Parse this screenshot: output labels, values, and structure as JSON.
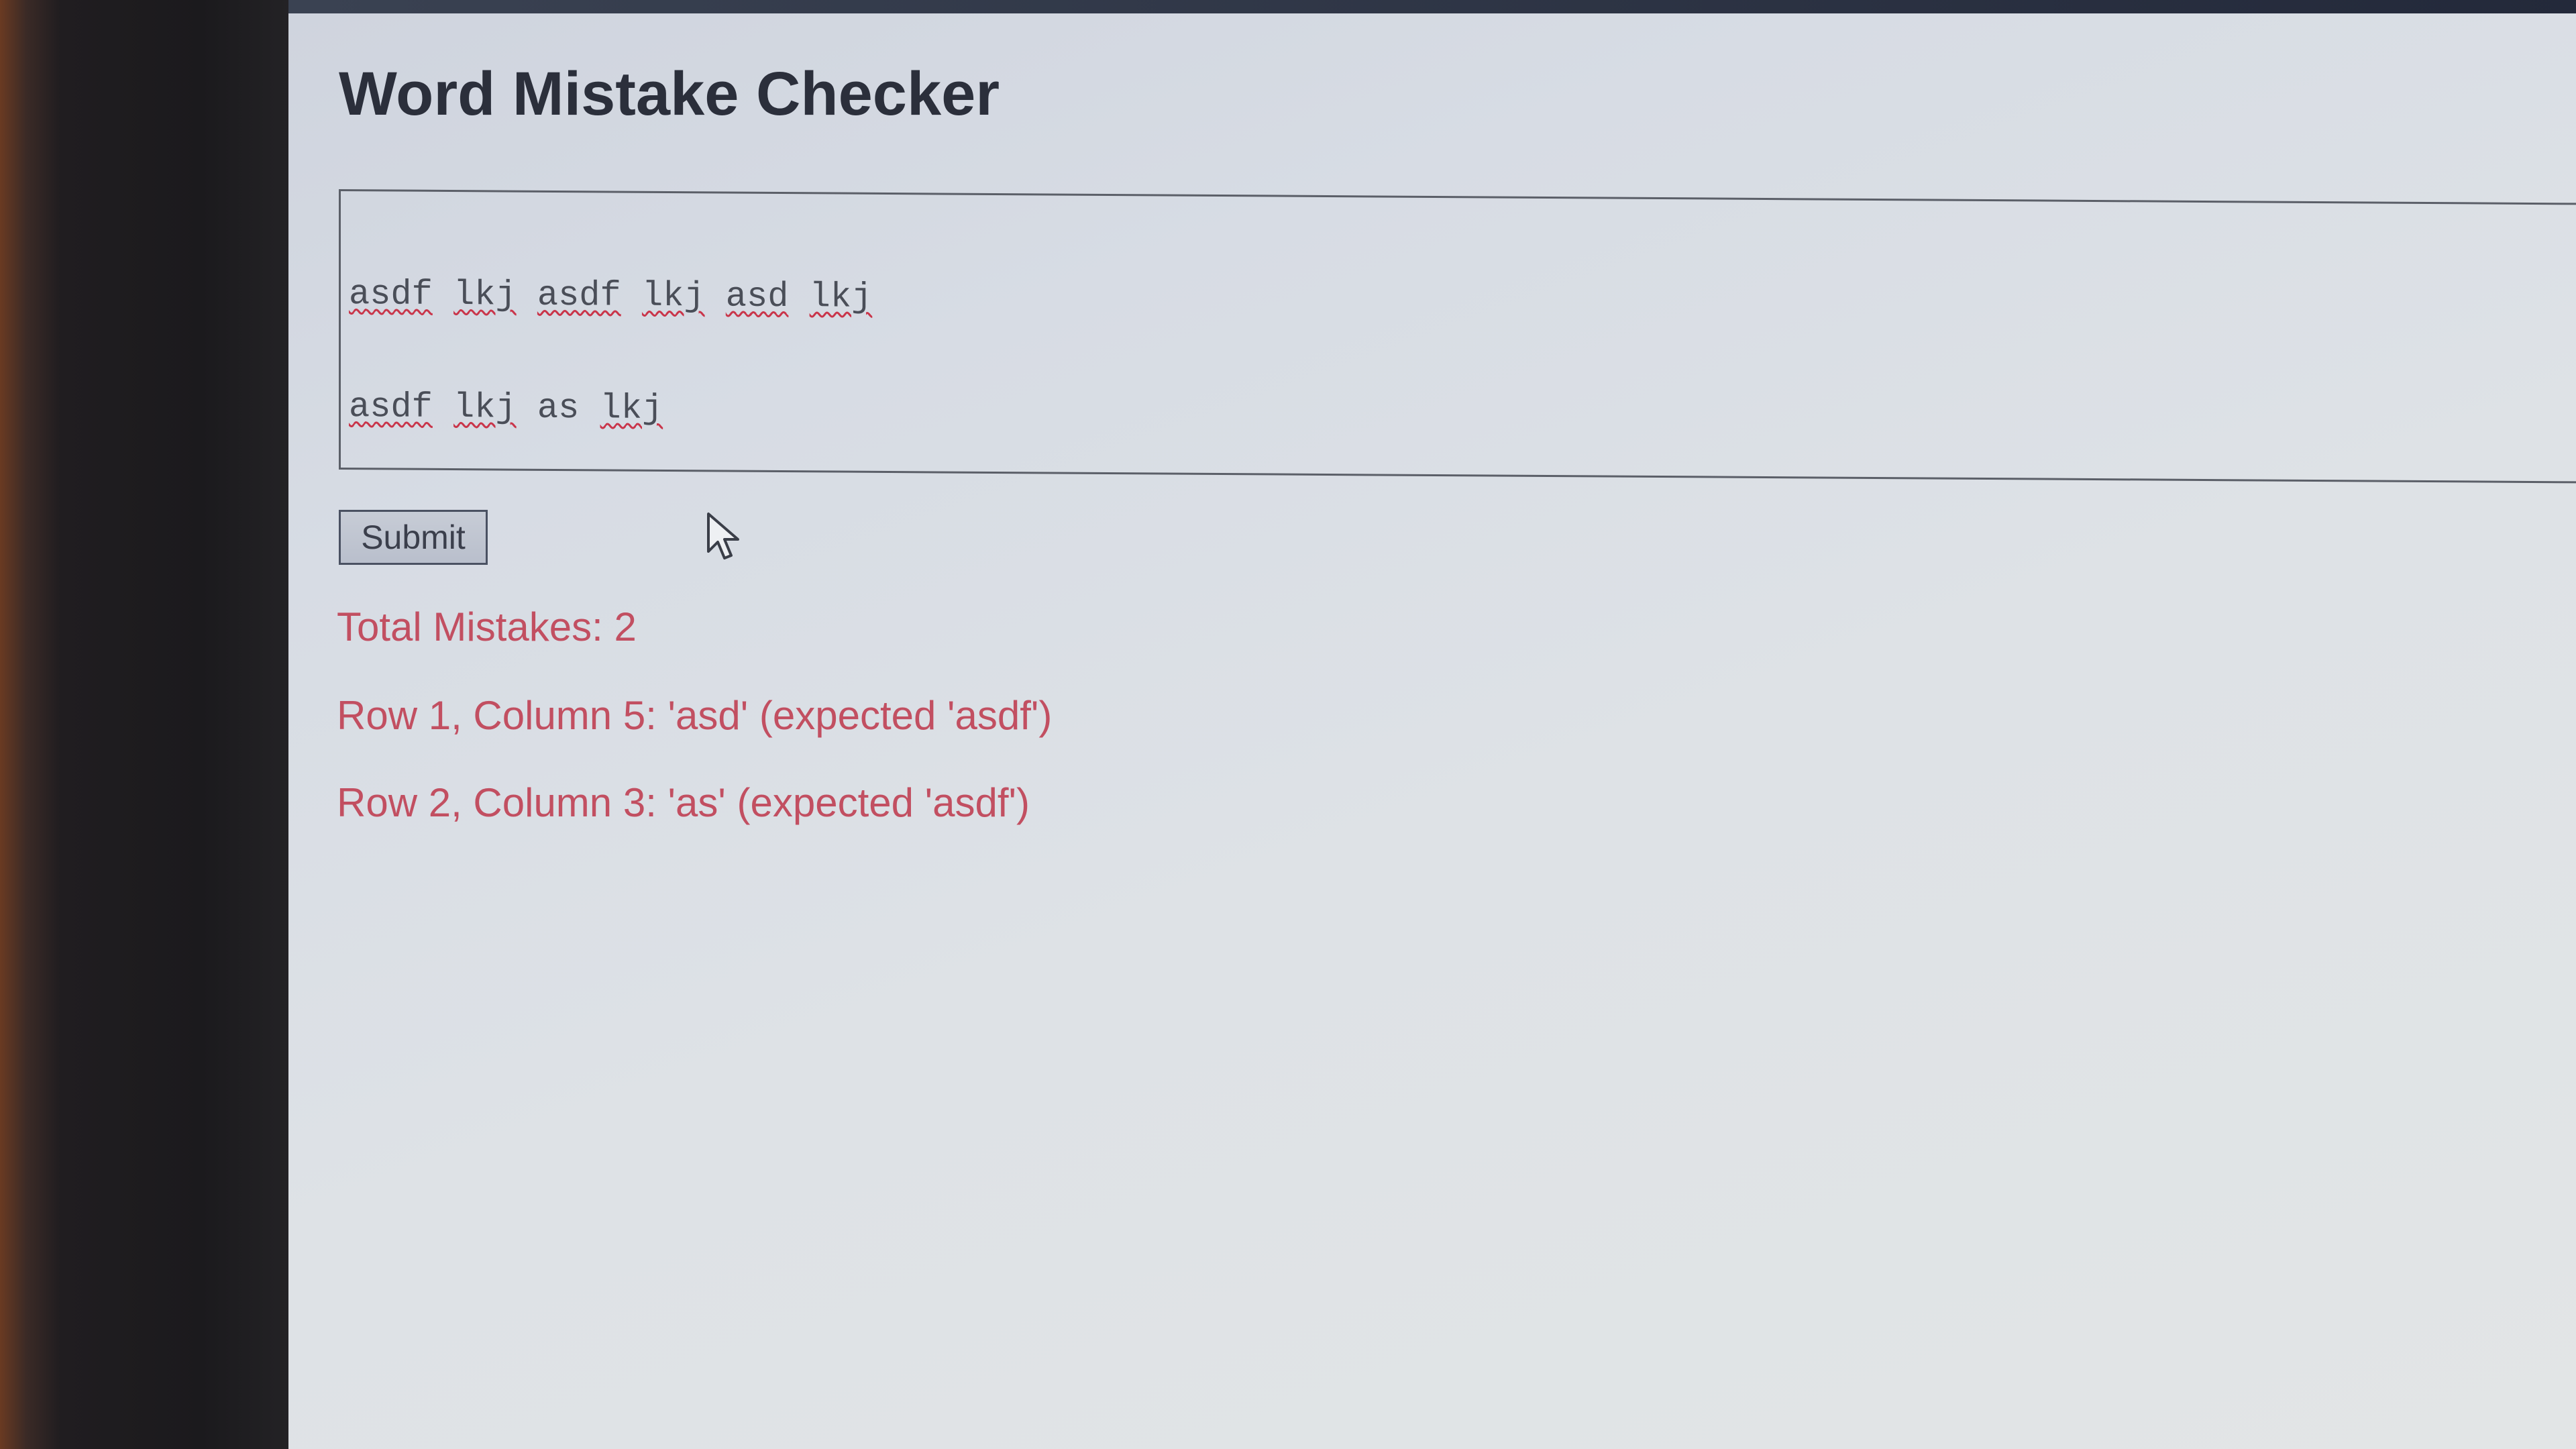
{
  "page": {
    "title": "Word Mistake Checker"
  },
  "editor": {
    "lines": [
      [
        "asdf",
        "lkj",
        "asdf",
        "lkj",
        "asd",
        "lkj"
      ],
      [
        "asdf",
        "lkj",
        "as",
        "lkj"
      ]
    ]
  },
  "form": {
    "submit_label": "Submit"
  },
  "results": {
    "total": "Total Mistakes: 2",
    "errors": [
      "Row 1, Column 5: 'asd' (expected 'asdf')",
      "Row 2, Column 3: 'as' (expected 'asdf')"
    ]
  },
  "colors": {
    "error_text": "#c24f61",
    "spellcheck_underline": "#c9354a"
  },
  "icons": {
    "cursor": "mouse-pointer-icon"
  }
}
